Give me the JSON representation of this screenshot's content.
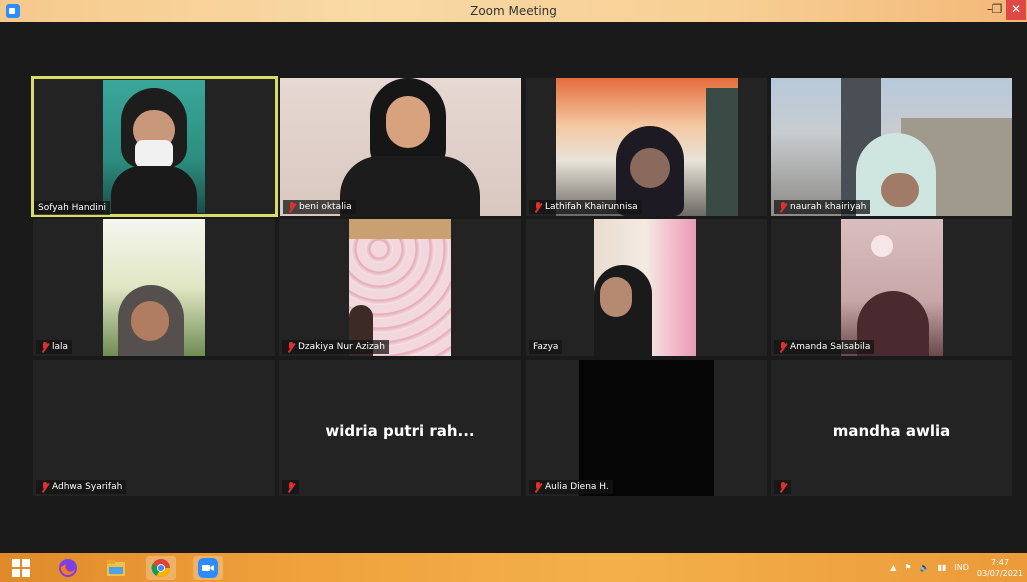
{
  "window": {
    "title": "Zoom Meeting",
    "minimize": "–",
    "restore": "❐",
    "close": "✕"
  },
  "tiles": [
    {
      "name": "Sofyah Handini",
      "muted": false
    },
    {
      "name": "beni oktalia",
      "muted": true
    },
    {
      "name": "Lathifah Khairunnisa",
      "muted": true
    },
    {
      "name": "naurah khairiyah",
      "muted": true
    },
    {
      "name": "lala",
      "muted": true
    },
    {
      "name": "Dzakiya Nur Azizah",
      "muted": true
    },
    {
      "name": "Fazya",
      "muted": false
    },
    {
      "name": "Amanda Salsabila",
      "muted": true
    },
    {
      "name": "Adhwa Syarifah",
      "muted": true
    },
    {
      "name": "",
      "muted": true,
      "display_name": "widria putri rah..."
    },
    {
      "name": "Aulia Diena H.",
      "muted": true
    },
    {
      "name": "",
      "muted": true,
      "display_name": "mandha awlia"
    }
  ],
  "taskbar": {
    "apps": [
      "windows-start",
      "firefox",
      "file-explorer",
      "chrome",
      "zoom"
    ],
    "tray": {
      "language": "IND",
      "time": "7:47",
      "date": "03/07/2021"
    }
  },
  "colors": {
    "active_speaker_border": "#d8dc6a",
    "tile_bg": "#232323",
    "muted_red": "#e02f2f"
  }
}
